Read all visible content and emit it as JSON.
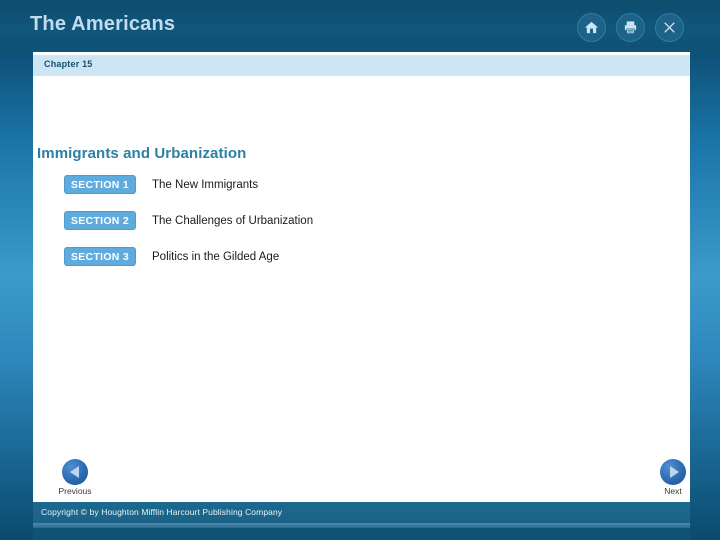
{
  "header": {
    "title": "The Americans",
    "icons": [
      {
        "name": "home-icon",
        "label": "Home"
      },
      {
        "name": "print-icon",
        "label": "Print"
      },
      {
        "name": "close-icon",
        "label": "Close"
      }
    ]
  },
  "page": {
    "chapter": "Chapter 15",
    "title": "Immigrants and Urbanization",
    "sections": [
      {
        "badge": "SECTION 1",
        "title": "The New Immigrants"
      },
      {
        "badge": "SECTION 2",
        "title": "The Challenges of Urbanization"
      },
      {
        "badge": "SECTION 3",
        "title": "Politics in the Gilded Age"
      }
    ]
  },
  "nav": {
    "previous": "Previous",
    "next": "Next"
  },
  "footer": {
    "copyright": "Copyright © by Houghton Mifflin Harcourt Publishing Company"
  },
  "colors": {
    "header_bg": "#0e5275",
    "chapter_bar": "#cee6f4",
    "title_text": "#2e7fa5",
    "badge_bg": "#5fabdd",
    "nav_circle": "#2a67ae",
    "copyright_bar": "#1b6286",
    "strip_accent": "#3d9acb"
  }
}
